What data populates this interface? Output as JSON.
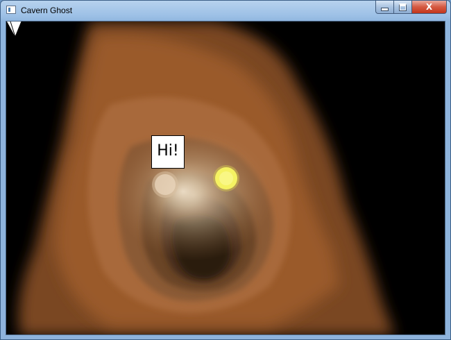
{
  "window": {
    "title": "Cavern Ghost",
    "icon": "app-window-icon",
    "controls": {
      "minimize_icon": "minimize-icon",
      "maximize_icon": "maximize-icon",
      "close_icon": "close-icon",
      "close_label": "X"
    }
  },
  "scene": {
    "background_color": "#000000",
    "cave_color": "#b06a35",
    "ghost_glow_color": "#e6d2b8",
    "eye_color": "#f4f061",
    "speech_bubble": {
      "text": "Hi!"
    }
  }
}
